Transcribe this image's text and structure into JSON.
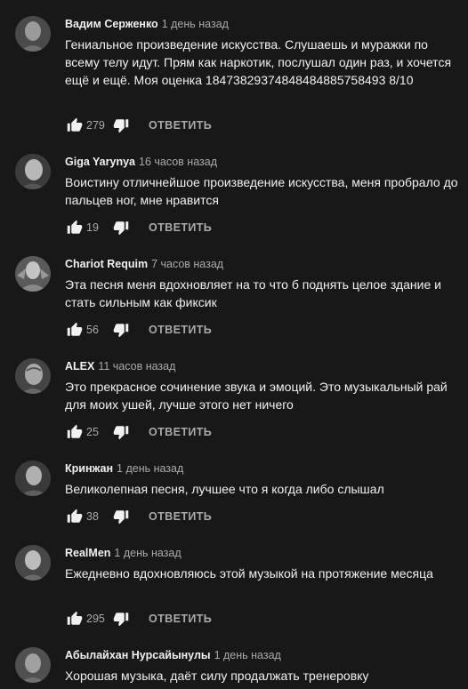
{
  "comments": [
    {
      "author": "Вадим Серженко",
      "time": "1 день назад",
      "text": "Гениальное произведение искусства. Слушаешь и муражки по всему телу идут. Прям как наркотик, послушал один раз, и хочется ещё и ещё. Моя оценка 18473829374848484885758493 8/10",
      "likes": "279",
      "reply": "ОТВЕТИТЬ"
    },
    {
      "author": "Giga Yarynya",
      "time": "16 часов назад",
      "text": "Воистину отличнейшое произведение искусства, меня пробрало до пальцев ног, мне нравится",
      "likes": "19",
      "reply": "ОТВЕТИТЬ"
    },
    {
      "author": "Chariot Requim",
      "time": "7 часов назад",
      "text": "Эта песня меня вдохновляет на то что б поднять целое здание и стать сильным как фиксик",
      "likes": "56",
      "reply": "ОТВЕТИТЬ"
    },
    {
      "author": "ALEX",
      "time": "11 часов назад",
      "text": "Это прекрасное сочинение звука и эмоций. Это музыкальный рай для моих ушей, лучше этого нет ничего",
      "likes": "25",
      "reply": "ОТВЕТИТЬ"
    },
    {
      "author": "Кринжан",
      "time": "1 день назад",
      "text": "Великолепная песня, лучшее что я когда либо слышал",
      "likes": "38",
      "reply": "ОТВЕТИТЬ"
    },
    {
      "author": "RealMen",
      "time": "1 день назад",
      "text": "Ежедневно вдохновляюсь этой музыкой на протяжение месяца",
      "likes": "295",
      "reply": "ОТВЕТИТЬ"
    },
    {
      "author": "Абылайхан Нурсайынулы",
      "time": "1 день назад",
      "text": "Хорошая музыка, даёт силу продалжать тренеровку",
      "likes": "",
      "reply": ""
    }
  ],
  "colors": {
    "background": "#181818",
    "text_primary": "#f1f1f1",
    "text_secondary": "#aaaaaa"
  }
}
